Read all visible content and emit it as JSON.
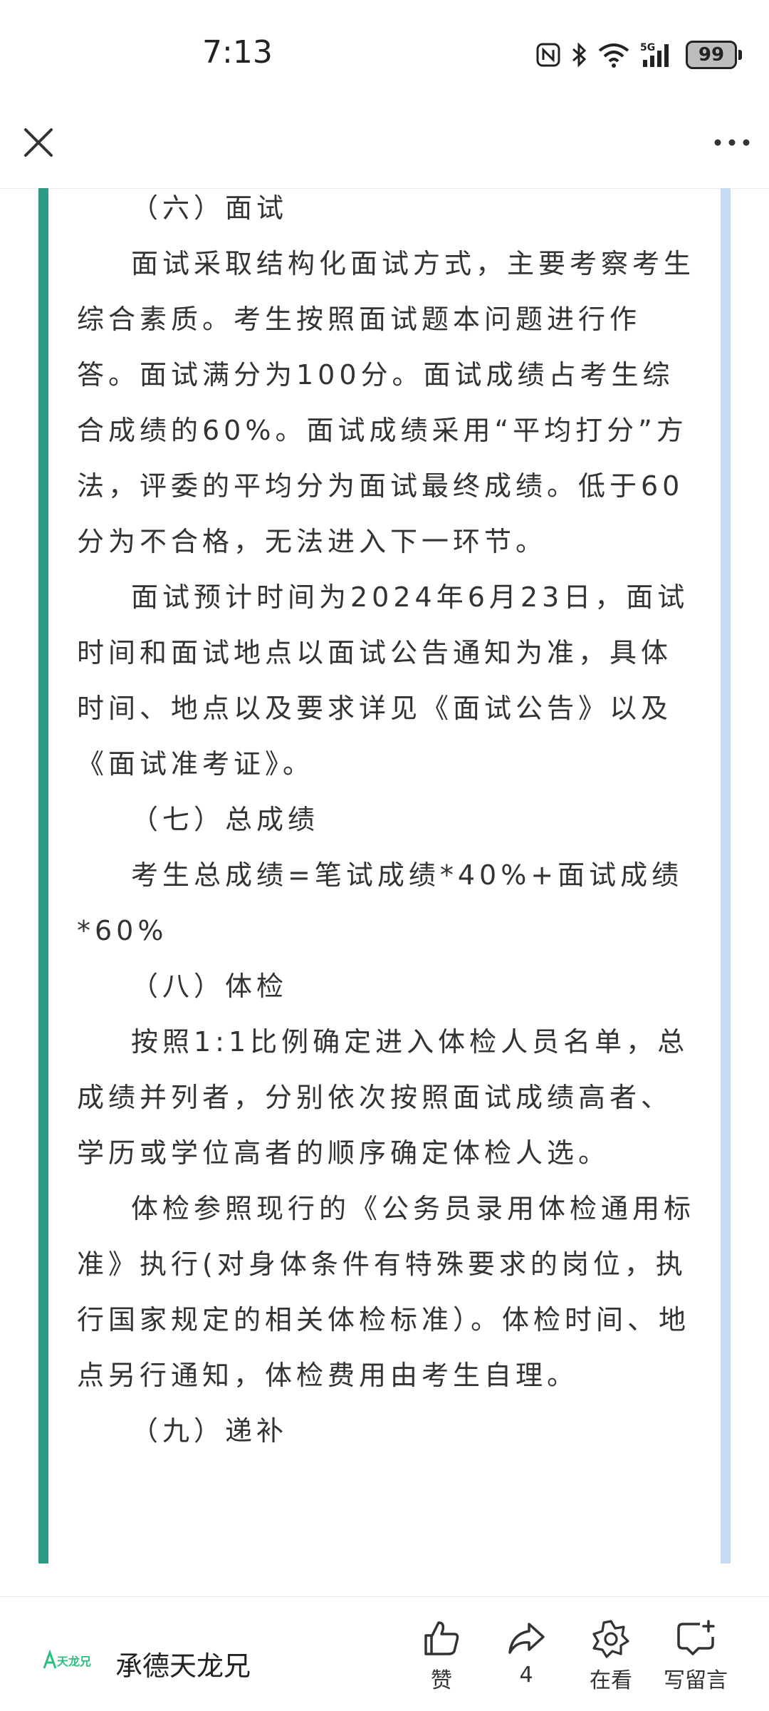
{
  "status_bar": {
    "time": "7:13",
    "network": "5G",
    "battery": "99"
  },
  "article": {
    "paragraphs": [
      "（六）面试",
      "面试采取结构化面试方式，主要考察考生综合素质。考生按照面试题本问题进行作答。面试满分为100分。面试成绩占考生综合成绩的60%。面试成绩采用“平均打分”方法，评委的平均分为面试最终成绩。低于60分为不合格，无法进入下一环节。",
      "面试预计时间为2024年6月23日，面试时间和面试地点以面试公告通知为准，具体时间、地点以及要求详见《面试公告》以及《面试准考证》。",
      "（七）总成绩",
      "考生总成绩=笔试成绩*40%+面试成绩*60%",
      "（八）体检",
      "按照1:1比例确定进入体检人员名单，总成绩并列者，分别依次按照面试成绩高者、学历或学位高者的顺序确定体检人选。",
      "体检参照现行的《公务员录用体检通用标准》执行(对身体条件有特殊要求的岗位，执行国家规定的相关体检标准）。体检时间、地点另行通知，体检费用由考生自理。",
      "（九）递补"
    ]
  },
  "bottom_bar": {
    "account_logo_text": "天龙兄",
    "account_name": "承德天龙兄",
    "like_label": "赞",
    "share_count": "4",
    "watching_label": "在看",
    "comment_label": "写留言"
  },
  "colors": {
    "left_bar": "#2e9a85",
    "right_bar": "#c4dcf3",
    "logo_green": "#2bbf7e"
  },
  "icons": [
    "close-icon",
    "more-icon",
    "nfc-icon",
    "bluetooth-icon",
    "wifi-icon",
    "signal-icon",
    "battery-icon",
    "like-icon",
    "share-icon",
    "watching-icon",
    "comment-icon"
  ]
}
